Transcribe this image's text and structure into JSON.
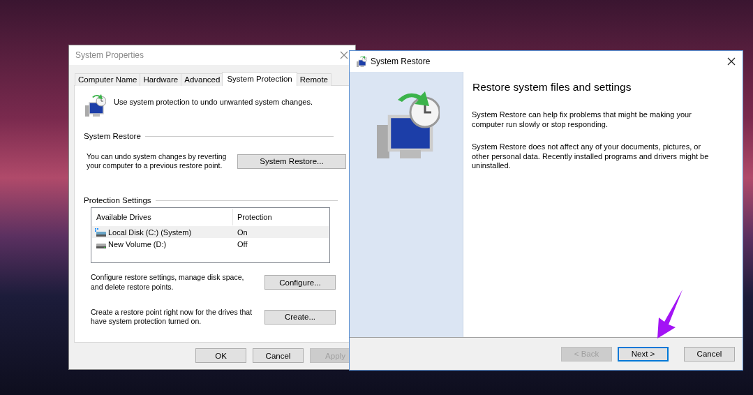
{
  "system_properties": {
    "title": "System Properties",
    "tabs": [
      {
        "label": "Computer Name",
        "selected": false
      },
      {
        "label": "Hardware",
        "selected": false
      },
      {
        "label": "Advanced",
        "selected": false
      },
      {
        "label": "System Protection",
        "selected": true
      },
      {
        "label": "Remote",
        "selected": false
      }
    ],
    "intro": "Use system protection to undo unwanted system changes.",
    "system_restore": {
      "heading": "System Restore",
      "text": "You can undo system changes by reverting your computer to a previous restore point.",
      "button": "System Restore..."
    },
    "protection_settings": {
      "heading": "Protection Settings",
      "columns": [
        "Available Drives",
        "Protection"
      ],
      "rows": [
        {
          "kind": "system",
          "drive": "Local Disk (C:) (System)",
          "protection": "On",
          "selected": true
        },
        {
          "kind": "plain",
          "drive": "New Volume (D:)",
          "protection": "Off",
          "selected": false
        }
      ],
      "actions": [
        {
          "text": "Configure restore settings, manage disk space, and delete restore points.",
          "button": "Configure..."
        },
        {
          "text": "Create a restore point right now for the drives that have system protection turned on.",
          "button": "Create..."
        }
      ]
    },
    "buttons": [
      {
        "label": "OK",
        "disabled": false
      },
      {
        "label": "Cancel",
        "disabled": false
      },
      {
        "label": "Apply",
        "disabled": true
      }
    ]
  },
  "system_restore": {
    "title": "System Restore",
    "heading": "Restore system files and settings",
    "paragraphs": [
      "System Restore can help fix problems that might be making your computer run slowly or stop responding.",
      "System Restore does not affect any of your documents, pictures, or other personal data. Recently installed programs and drivers might be uninstalled."
    ],
    "buttons": [
      {
        "label": "< Back",
        "disabled": true,
        "focused": false
      },
      {
        "label": "Next >",
        "disabled": false,
        "focused": true
      },
      {
        "label": "Cancel",
        "disabled": false,
        "focused": false
      }
    ]
  }
}
